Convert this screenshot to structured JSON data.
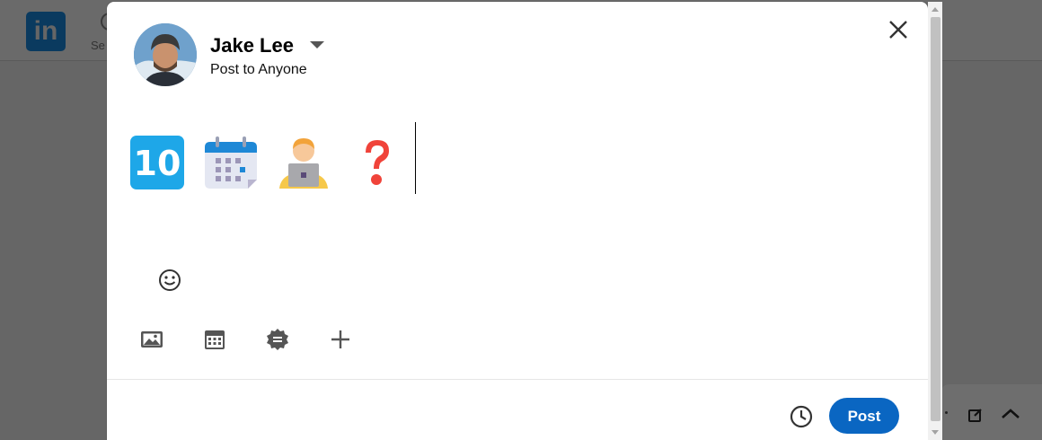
{
  "background": {
    "logo_text": "in",
    "search_partial": "Se"
  },
  "composer": {
    "user_name": "Jake Lee",
    "visibility": "Post to Anyone",
    "emojis": [
      "keycap-ten-icon",
      "calendar-icon",
      "technologist-icon",
      "red-question-mark-icon"
    ],
    "post_label": "Post",
    "accent": "#0a66c2"
  },
  "toolbar": {
    "icons": [
      "emoji-icon",
      "image-icon",
      "calendar-event-icon",
      "celebrate-badge-icon",
      "plus-icon"
    ]
  }
}
